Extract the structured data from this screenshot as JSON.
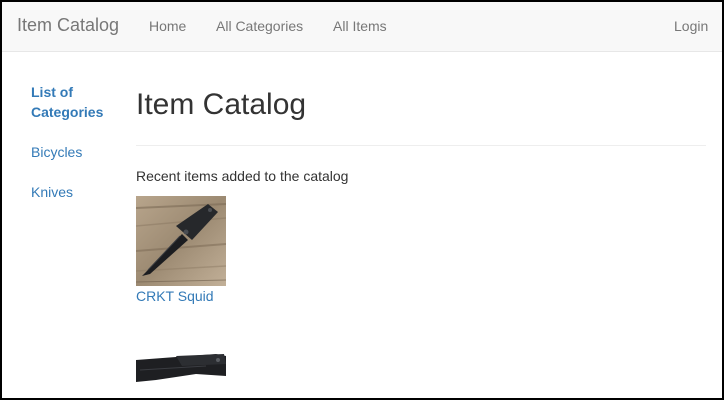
{
  "navbar": {
    "brand": "Item Catalog",
    "links": [
      {
        "label": "Home"
      },
      {
        "label": "All Categories"
      },
      {
        "label": "All Items"
      }
    ],
    "login_label": "Login"
  },
  "sidebar": {
    "title": "List of Categories",
    "categories": [
      {
        "label": "Bicycles"
      },
      {
        "label": "Knives"
      }
    ]
  },
  "main": {
    "title": "Item Catalog",
    "recent_caption": "Recent items added to the catalog",
    "items": [
      {
        "name": "CRKT Squid",
        "image_icon": "folding-knife-photo"
      },
      {
        "name": "",
        "image_icon": "folding-knife-photo"
      }
    ]
  },
  "colors": {
    "link": "#337ab7",
    "navbar_bg": "#f8f8f8",
    "navbar_text": "#777777"
  }
}
